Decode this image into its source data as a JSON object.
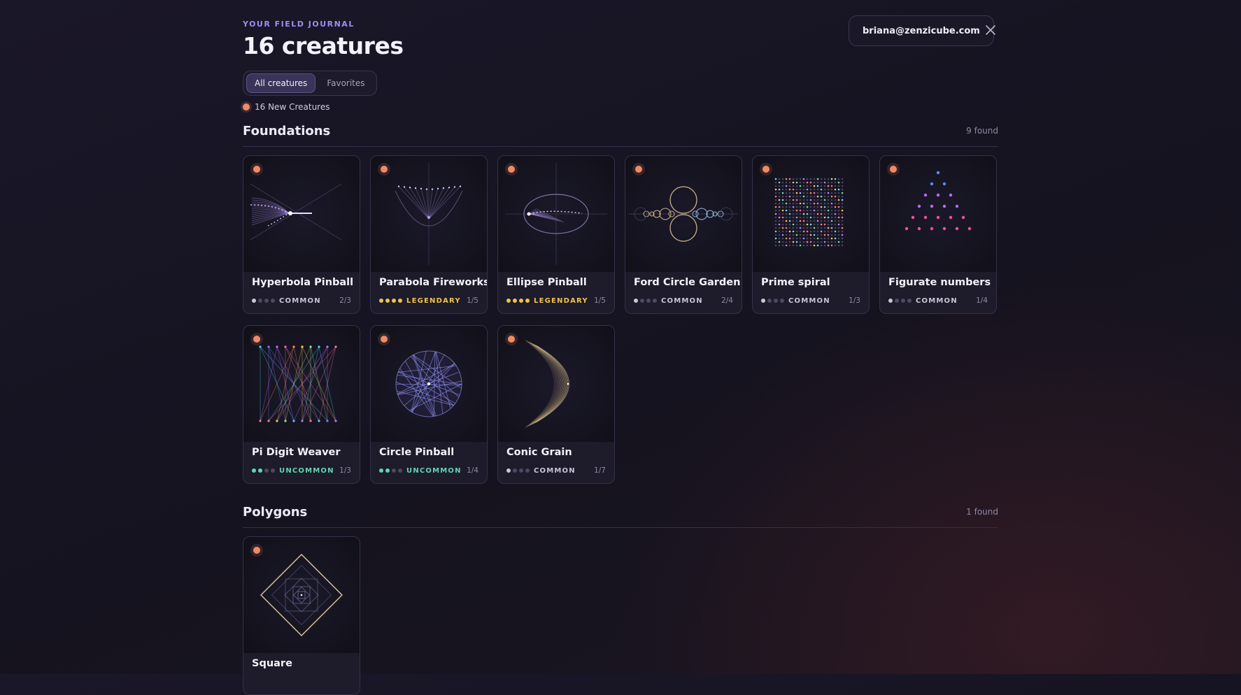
{
  "header": {
    "eyebrow": "YOUR FIELD JOURNAL",
    "title": "16 creatures",
    "tabs": [
      "All creatures",
      "Favorites"
    ],
    "active_tab": "All creatures",
    "new_label": "16 New Creatures",
    "email": "briana@zenzicube.com",
    "close_icon": "close-icon"
  },
  "colors": {
    "accent": "#9d8ff0",
    "new_dot": "#f08a66",
    "common": "#c9c6d8",
    "uncommon": "#5fd6b4",
    "legendary": "#f1c24a"
  },
  "sections": [
    {
      "title": "Foundations",
      "count": "9 found",
      "cards": [
        {
          "name": "Hyperbola Pinball",
          "rarity": "COMMON",
          "level": 1,
          "progress": "2/3"
        },
        {
          "name": "Parabola Fireworks",
          "rarity": "LEGENDARY",
          "level": 4,
          "progress": "1/5"
        },
        {
          "name": "Ellipse Pinball",
          "rarity": "LEGENDARY",
          "level": 4,
          "progress": "1/5"
        },
        {
          "name": "Ford Circle Garden",
          "rarity": "COMMON",
          "level": 1,
          "progress": "2/4"
        },
        {
          "name": "Prime spiral",
          "rarity": "COMMON",
          "level": 1,
          "progress": "1/3"
        },
        {
          "name": "Figurate numbers",
          "rarity": "COMMON",
          "level": 1,
          "progress": "1/4"
        },
        {
          "name": "Pi Digit Weaver",
          "rarity": "UNCOMMON",
          "level": 2,
          "progress": "1/3"
        },
        {
          "name": "Circle Pinball",
          "rarity": "UNCOMMON",
          "level": 2,
          "progress": "1/4"
        },
        {
          "name": "Conic Grain",
          "rarity": "COMMON",
          "level": 1,
          "progress": "1/7"
        }
      ]
    },
    {
      "title": "Polygons",
      "count": "1 found",
      "cards": [
        {
          "name": "Square",
          "rarity": "",
          "level": 0,
          "progress": ""
        }
      ]
    }
  ]
}
